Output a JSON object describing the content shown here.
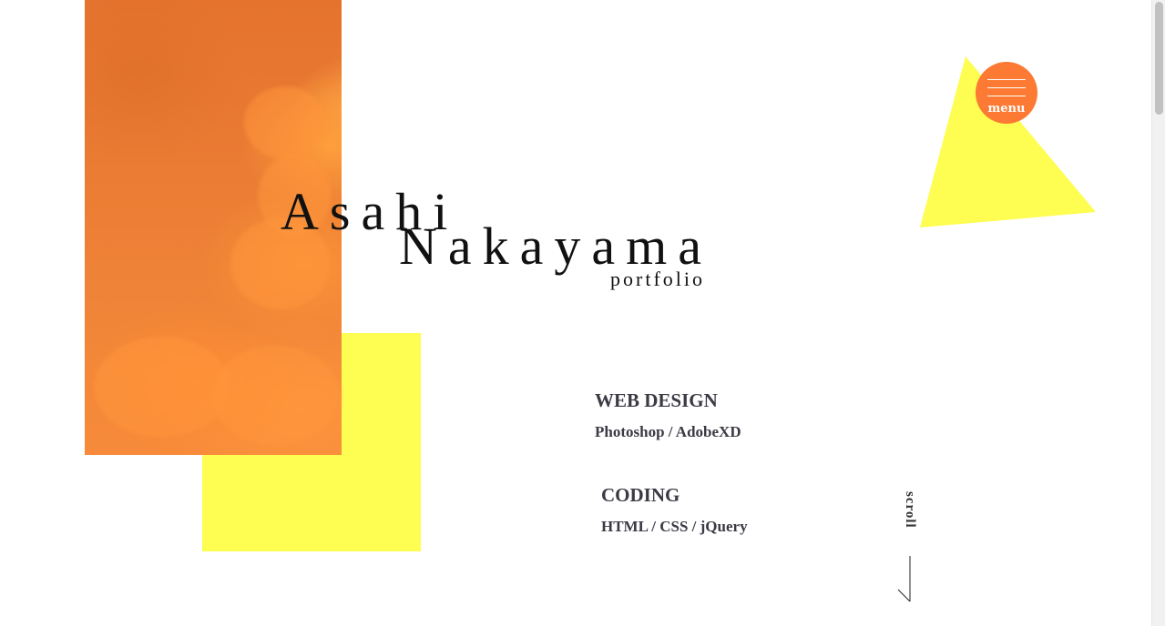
{
  "hero": {
    "first_name": "Asahi",
    "last_name": "Nakayama",
    "subtitle": "portfolio"
  },
  "menu": {
    "label": "menu",
    "icon": "hamburger-icon"
  },
  "skills": [
    {
      "heading": "WEB DESIGN",
      "tools": "Photoshop / AdobeXD"
    },
    {
      "heading": "CODING",
      "tools": "HTML / CSS / jQuery"
    }
  ],
  "scroll": {
    "label": "scroll",
    "icon": "scroll-arrow-icon"
  },
  "colors": {
    "orange": "#fc7a33",
    "sky_orange": "#ea7b33",
    "yellow": "#fefd51",
    "text": "#111111",
    "skill_text": "#3a3a44"
  }
}
